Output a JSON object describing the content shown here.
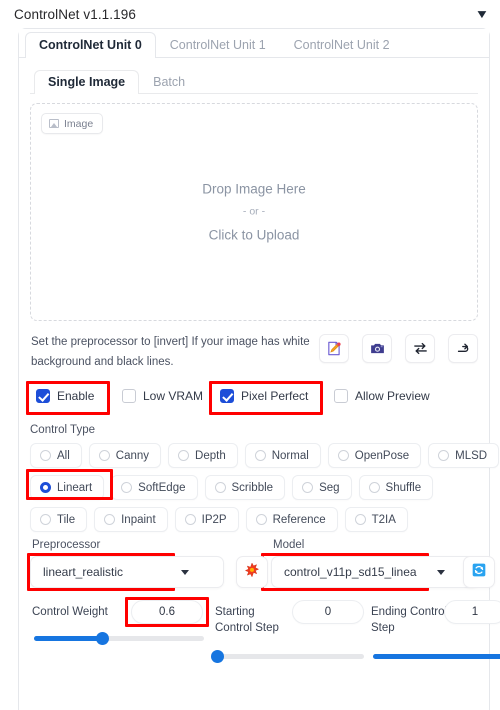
{
  "header": {
    "title": "ControlNet v1.1.196",
    "chevron": "▼"
  },
  "unit_tabs": [
    {
      "label": "ControlNet Unit 0",
      "active": true
    },
    {
      "label": "ControlNet Unit 1",
      "active": false
    },
    {
      "label": "ControlNet Unit 2",
      "active": false
    }
  ],
  "source_tabs": [
    {
      "label": "Single Image",
      "active": true
    },
    {
      "label": "Batch",
      "active": false
    }
  ],
  "dropzone": {
    "badge_label": "Image",
    "line1": "Drop Image Here",
    "line2": "- or -",
    "line3": "Click to Upload"
  },
  "hint": {
    "text": "Set the preprocessor to [invert] If your image has white background and black lines.",
    "icons": [
      {
        "name": "edit-image-icon",
        "title": "Edit"
      },
      {
        "name": "camera-icon",
        "title": "Webcam"
      },
      {
        "name": "swap-arrows-icon",
        "title": "Swap"
      },
      {
        "name": "send-arrow-icon",
        "title": "Send"
      }
    ]
  },
  "checkboxes": [
    {
      "label": "Enable",
      "checked": true,
      "highlighted": true
    },
    {
      "label": "Low VRAM",
      "checked": false,
      "highlighted": false
    },
    {
      "label": "Pixel Perfect",
      "checked": true,
      "highlighted": true
    },
    {
      "label": "Allow Preview",
      "checked": false,
      "highlighted": false
    }
  ],
  "control_type": {
    "title": "Control Type",
    "selected": "Lineart",
    "rows": [
      [
        {
          "label": "All",
          "selected": false
        },
        {
          "label": "Canny",
          "selected": false
        },
        {
          "label": "Depth",
          "selected": false
        },
        {
          "label": "Normal",
          "selected": false
        },
        {
          "label": "OpenPose",
          "selected": false
        },
        {
          "label": "MLSD",
          "selected": false
        }
      ],
      [
        {
          "label": "Lineart",
          "selected": true
        },
        {
          "label": "SoftEdge",
          "selected": false
        },
        {
          "label": "Scribble",
          "selected": false
        },
        {
          "label": "Seg",
          "selected": false
        },
        {
          "label": "Shuffle",
          "selected": false
        }
      ],
      [
        {
          "label": "Tile",
          "selected": false
        },
        {
          "label": "Inpaint",
          "selected": false
        },
        {
          "label": "IP2P",
          "selected": false
        },
        {
          "label": "Reference",
          "selected": false
        },
        {
          "label": "T2IA",
          "selected": false
        }
      ]
    ]
  },
  "preprocessor": {
    "label": "Preprocessor",
    "value": "lineart_realistic",
    "run_icon": "burst-star-icon"
  },
  "model": {
    "label": "Model",
    "value": "control_v11p_sd15_linea",
    "refresh_icon": "refresh-icon"
  },
  "sliders": {
    "control_weight": {
      "label": "Control Weight",
      "value": "0.6",
      "percent": 40,
      "highlighted": true
    },
    "starting_control_step": {
      "label": "Starting Control Step",
      "value": "0",
      "percent": 0,
      "highlighted": false
    },
    "ending_control_step": {
      "label": "Ending Control Step",
      "value": "1",
      "percent": 100,
      "highlighted": false
    }
  },
  "colors": {
    "accent_blue": "#1d4ed8",
    "slider_blue": "#1675e0",
    "highlight_red": "#ff0000",
    "refresh_blue": "#2196f3"
  }
}
